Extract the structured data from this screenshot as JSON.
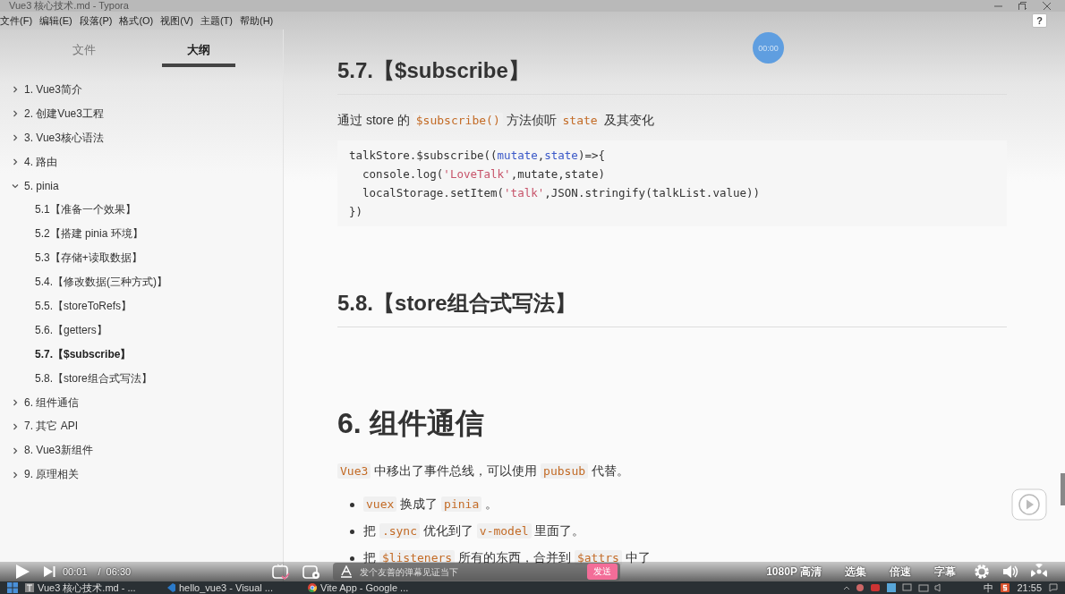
{
  "window": {
    "title": "Vue3 核心技术.md - Typora"
  },
  "help": "?",
  "menu": [
    "文件(F)",
    "编辑(E)",
    "段落(P)",
    "格式(O)",
    "视图(V)",
    "主题(T)",
    "帮助(H)"
  ],
  "sidebar": {
    "tabs": [
      {
        "label": "文件",
        "selected": false
      },
      {
        "label": "大纲",
        "selected": true
      }
    ],
    "outline": [
      {
        "label": "1. Vue3简介",
        "expanded": false,
        "selected": false
      },
      {
        "label": "2. 创建Vue3工程",
        "expanded": false,
        "selected": false
      },
      {
        "label": "3. Vue3核心语法",
        "expanded": false,
        "selected": false
      },
      {
        "label": "4. 路由",
        "expanded": false,
        "selected": false
      },
      {
        "label": "5. pinia",
        "expanded": true,
        "selected": false,
        "children": [
          {
            "label": "5.1【准备一个效果】",
            "selected": false
          },
          {
            "label": "5.2【搭建 pinia 环境】",
            "selected": false
          },
          {
            "label": "5.3【存储+读取数据】",
            "selected": false
          },
          {
            "label": "5.4.【修改数据(三种方式)】",
            "selected": false
          },
          {
            "label": "5.5.【storeToRefs】",
            "selected": false
          },
          {
            "label": "5.6.【getters】",
            "selected": false
          },
          {
            "label": "5.7.【$subscribe】",
            "selected": true
          },
          {
            "label": "5.8.【store组合式写法】",
            "selected": false
          }
        ]
      },
      {
        "label": "6. 组件通信",
        "expanded": false,
        "selected": false
      },
      {
        "label": "7. 其它 API",
        "expanded": false,
        "selected": false
      },
      {
        "label": "8. Vue3新组件",
        "expanded": false,
        "selected": false
      },
      {
        "label": "9. 原理相关",
        "expanded": false,
        "selected": false
      }
    ]
  },
  "timer": "00:00",
  "content": [
    {
      "kind": "h2",
      "text": "5.7.【$subscribe】"
    },
    {
      "kind": "p",
      "parts": [
        {
          "text": "通过 store 的 ",
          "code": false
        },
        {
          "text": "$subscribe()",
          "code": true
        },
        {
          "text": " 方法侦听 ",
          "code": false
        },
        {
          "text": "state",
          "code": true
        },
        {
          "text": " 及其变化",
          "code": false
        }
      ]
    },
    {
      "kind": "code",
      "lines": [
        [
          {
            "text": "talkStore.$subscribe((",
            "kind": "plain"
          },
          {
            "text": "mutate",
            "kind": "param"
          },
          {
            "text": ",",
            "kind": "plain"
          },
          {
            "text": "state",
            "kind": "param"
          },
          {
            "text": ")=>{",
            "kind": "plain"
          }
        ],
        [
          {
            "text": "  console.log(",
            "kind": "plain"
          },
          {
            "text": "'LoveTalk'",
            "kind": "string"
          },
          {
            "text": ",mutate,state)",
            "kind": "plain"
          }
        ],
        [
          {
            "text": "  localStorage.setItem(",
            "kind": "plain"
          },
          {
            "text": "'talk'",
            "kind": "string"
          },
          {
            "text": ",JSON.stringify(talkList.value))",
            "kind": "plain"
          }
        ],
        [
          {
            "text": "})",
            "kind": "plain"
          }
        ]
      ]
    },
    {
      "kind": "h2",
      "text": "5.8.【store组合式写法】"
    },
    {
      "kind": "h1",
      "text": "6. 组件通信"
    },
    {
      "kind": "p",
      "parts": [
        {
          "text": "Vue3",
          "code": true
        },
        {
          "text": " 中移出了事件总线，可以使用 ",
          "code": false
        },
        {
          "text": "pubsub",
          "code": true
        },
        {
          "text": " 代替。",
          "code": false
        }
      ]
    },
    {
      "kind": "ul",
      "items": [
        [
          {
            "text": "vuex",
            "code": true
          },
          {
            "text": " 换成了 ",
            "code": false
          },
          {
            "text": "pinia",
            "code": true
          },
          {
            "text": " 。",
            "code": false
          }
        ],
        [
          {
            "text": "把 ",
            "code": false
          },
          {
            "text": ".sync",
            "code": true
          },
          {
            "text": " 优化到了 ",
            "code": false
          },
          {
            "text": "v-model",
            "code": true
          },
          {
            "text": " 里面了。",
            "code": false
          }
        ],
        [
          {
            "text": "把 ",
            "code": false
          },
          {
            "text": "$listeners",
            "code": true
          },
          {
            "text": " 所有的东西，合并到 ",
            "code": false
          },
          {
            "text": "$attrs",
            "code": true
          },
          {
            "text": " 中了",
            "code": false
          }
        ]
      ]
    }
  ],
  "player": {
    "current": "00:01",
    "separator": "/",
    "duration": "06:30",
    "danmaku_placeholder": "发个友善的弹幕见证当下",
    "send": "发送",
    "quality": "1080P 高清",
    "buttons": [
      "选集",
      "倍速",
      "字幕"
    ]
  },
  "taskbar": {
    "apps": [
      {
        "label": "Vue3 核心技术.md - ...",
        "kind": "typora"
      },
      {
        "label": "hello_vue3 - Visual ...",
        "kind": "vscode"
      },
      {
        "label": "Vite App - Google ...",
        "kind": "chrome"
      }
    ],
    "ime": "中",
    "time": "21:55"
  }
}
